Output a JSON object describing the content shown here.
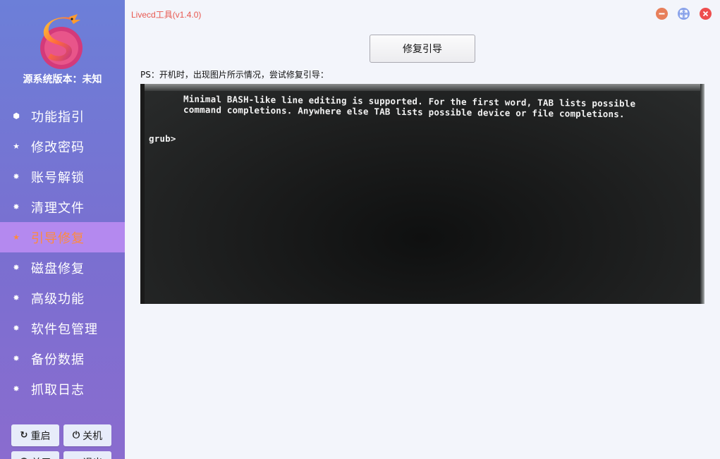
{
  "app": {
    "title": "Livecd工具(v1.4.0)",
    "source_version": "源系统版本：未知"
  },
  "colors": {
    "sidebar_top": "#6c7fd8",
    "sidebar_bottom": "#8a6ccf",
    "active_item_bg": "#b489ef",
    "active_item_text": "#ff8a3c",
    "title_text": "#e8584f"
  },
  "sidebar": {
    "items": [
      {
        "label": "功能指引",
        "icon": "cube-icon",
        "glyph": "⬢",
        "active": false
      },
      {
        "label": "修改密码",
        "icon": "star-icon",
        "glyph": "★",
        "active": false
      },
      {
        "label": "账号解锁",
        "icon": "gear-icon",
        "glyph": "✸",
        "active": false
      },
      {
        "label": "清理文件",
        "icon": "gear-icon",
        "glyph": "✸",
        "active": false
      },
      {
        "label": "引导修复",
        "icon": "star-icon",
        "glyph": "★",
        "active": true
      },
      {
        "label": "磁盘修复",
        "icon": "gear-icon",
        "glyph": "✸",
        "active": false
      },
      {
        "label": "高级功能",
        "icon": "gear-icon",
        "glyph": "✸",
        "active": false
      },
      {
        "label": "软件包管理",
        "icon": "gear-icon",
        "glyph": "✸",
        "active": false
      },
      {
        "label": "备份数据",
        "icon": "gear-icon",
        "glyph": "✸",
        "active": false
      },
      {
        "label": "抓取日志",
        "icon": "gear-icon",
        "glyph": "✸",
        "active": false
      }
    ],
    "buttons": [
      {
        "label": "重启",
        "icon": "restart-icon",
        "glyph": "↻"
      },
      {
        "label": "关机",
        "icon": "power-icon",
        "glyph": "⏻"
      },
      {
        "label": "关于",
        "icon": "info-icon",
        "glyph": "⓵"
      },
      {
        "label": "退出",
        "icon": "exit-icon",
        "glyph": "⇥"
      }
    ]
  },
  "main": {
    "repair_button": "修复引导",
    "ps_text": "PS：开机时，出现图片所示情况，尝试修复引导：",
    "screen": {
      "line1": "Minimal BASH-like line editing is supported. For the first word, TAB lists possible",
      "line2": "command completions. Anywhere else TAB lists possible device or file completions.",
      "prompt": "grub>"
    }
  }
}
